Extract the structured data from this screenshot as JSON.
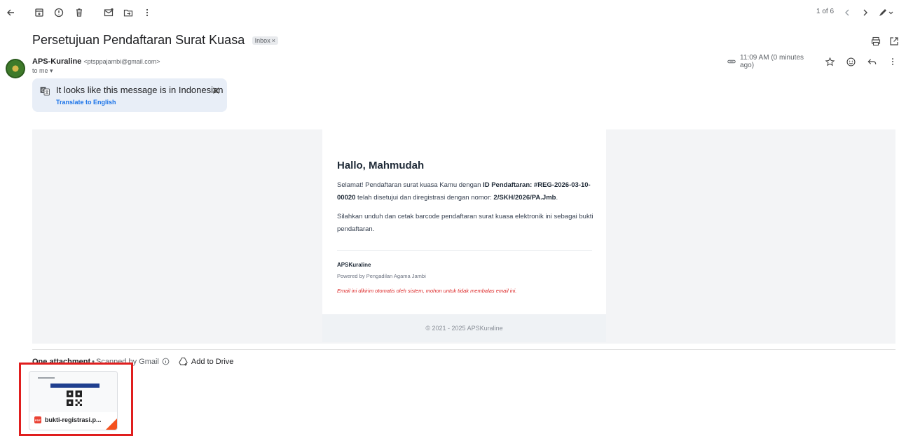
{
  "toolbar": {
    "icons": [
      "back-arrow-icon",
      "archive-icon",
      "report-spam-icon",
      "delete-icon",
      "mark-unread-icon",
      "move-to-icon",
      "more-vert-icon"
    ],
    "pager": "1 of 6"
  },
  "message": {
    "subject": "Persetujuan Pendaftaran Surat Kuasa",
    "label": "Inbox",
    "label_close": "×",
    "sender_name": "APS-Kuraline",
    "sender_email": "<ptsppajambi@gmail.com>",
    "to": "to me ▾",
    "time": "11:09 AM (0 minutes ago)"
  },
  "translate": {
    "text": "It looks like this message is in Indonesian",
    "link": "Translate to English",
    "close": "✕"
  },
  "email_body": {
    "greeting": "Hallo, Mahmudah",
    "para1_a": "Selamat! Pendaftaran surat kuasa Kamu dengan ",
    "para1_b": "ID Pendaftaran: #REG-2026-03-10-00020",
    "para1_c": " telah disetujui dan diregistrasi dengan nomor: ",
    "para1_d": "2/SKH/2026/PA.Jmb",
    "para1_e": ".",
    "para2": "Silahkan unduh dan cetak barcode pendaftaran surat kuasa elektronik ini sebagai bukti pendaftaran.",
    "brand": "APSKuraline",
    "powered": "Powered by Pengadilan Agama Jambi",
    "notice": "Email ini dikirim otomatis oleh sistem, mohon untuk tidak membalas email ini.",
    "footer": "© 2021 - 2025 APSKuraline"
  },
  "attachments": {
    "count_label": "One attachment",
    "separator": " • ",
    "scanned": "Scanned by Gmail",
    "add_to_drive": "Add to Drive",
    "file_name": "bukti-registrasi.p...",
    "file_type": "PDF"
  },
  "colors": {
    "accent": "#1a73e8",
    "highlight": "#e01e1e",
    "notice": "#dc2626"
  }
}
